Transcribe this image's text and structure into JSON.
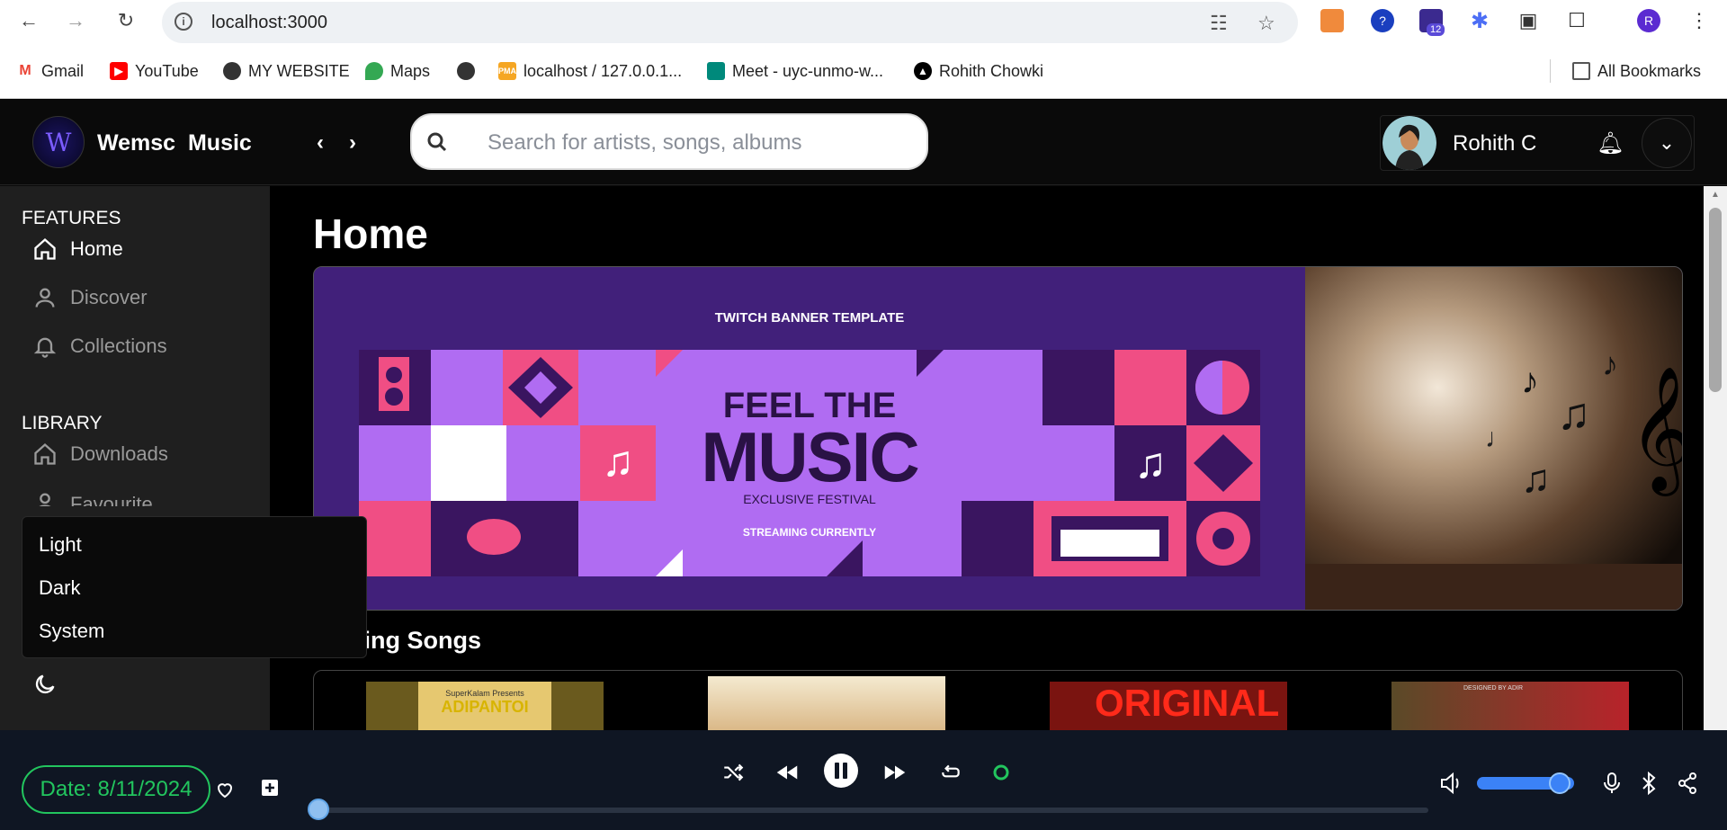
{
  "browser": {
    "url": "localhost:3000",
    "profile_initial": "R",
    "extension_badge": "12",
    "bookmarks": [
      {
        "label": "Gmail"
      },
      {
        "label": "YouTube"
      },
      {
        "label": "MY WEBSITE"
      },
      {
        "label": "Maps"
      },
      {
        "label": ""
      },
      {
        "label": "localhost / 127.0.0.1..."
      },
      {
        "label": "Meet - uyc-unmo-w..."
      },
      {
        "label": "Rohith Chowki"
      }
    ],
    "all_bookmarks": "All Bookmarks"
  },
  "app": {
    "title": "Wemsc  Music",
    "logo_letter": "W",
    "search_placeholder": "Search for artists, songs, albums",
    "user_name": "Rohith C"
  },
  "sidebar": {
    "features_heading": "FEATURES",
    "features": [
      {
        "label": "Home",
        "icon": "home-icon",
        "active": true
      },
      {
        "label": "Discover",
        "icon": "user-icon"
      },
      {
        "label": "Collections",
        "icon": "bell-icon"
      }
    ],
    "library_heading": "LIBRARY",
    "library": [
      {
        "label": "Downloads",
        "icon": "home-icon"
      },
      {
        "label": "Favourite",
        "icon": "user-icon"
      }
    ],
    "theme_options": [
      "Light",
      "Dark",
      "System"
    ]
  },
  "main": {
    "page_title": "Home",
    "banner": {
      "subtitle_top": "TWITCH BANNER TEMPLATE",
      "line1": "FEEL THE",
      "line2": "MUSIC",
      "line3": "EXCLUSIVE FESTIVAL",
      "line4": "STREAMING CURRENTLY"
    },
    "trending_heading": "ding Songs",
    "thumbs": [
      {
        "caption": "ADIPANTOI",
        "top_text": "SuperKalam Presents"
      },
      {
        "caption": ""
      },
      {
        "caption": "ORIGINAL"
      },
      {
        "caption": "DESIGNED BY ADIR"
      }
    ]
  },
  "player": {
    "date_label": "Date: 8/11/2024",
    "progress": 0,
    "volume": 0.85
  },
  "colors": {
    "accent_green": "#22c55e",
    "volume_blue": "#3b82f6",
    "banner_purple": "#41207a",
    "banner_pink": "#f04e84",
    "banner_lilac": "#b06cf2"
  }
}
